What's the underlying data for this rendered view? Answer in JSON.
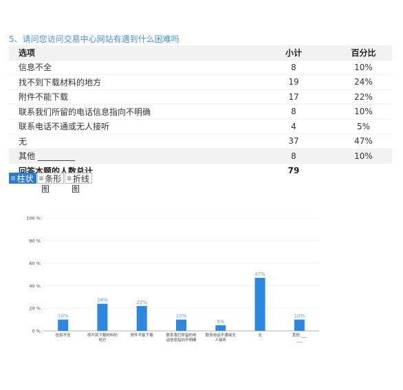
{
  "question": {
    "title": "5、请问您访问交易中心网站有遇到什么困难吗"
  },
  "table": {
    "headers": [
      "选项",
      "小计",
      "百分比"
    ],
    "rows": [
      {
        "option": "信息不全",
        "count": "8",
        "pct": "10%"
      },
      {
        "option": "找不到下载材料的地方",
        "count": "19",
        "pct": "24%"
      },
      {
        "option": "附件不能下载",
        "count": "17",
        "pct": "22%"
      },
      {
        "option": "联系我们所留的电话信息指向不明确",
        "count": "8",
        "pct": "10%"
      },
      {
        "option": "联系电话不通或无人接听",
        "count": "4",
        "pct": "5%"
      },
      {
        "option": "无",
        "count": "37",
        "pct": "47%"
      },
      {
        "option": "其他 _________",
        "count": "8",
        "pct": "10%"
      }
    ],
    "total_label": "回答本题的人数总计",
    "total_value": "79"
  },
  "chart_tabs": {
    "bar_col": "柱状",
    "bar_row": "条形",
    "line": "折线",
    "sub_char": "图"
  },
  "colors": {
    "bar": "#2b87e0",
    "accent": "#2b7bd3",
    "title": "#4a90d9"
  },
  "chart_data": {
    "type": "bar",
    "categories": [
      "信息不全",
      "找不到下载材料的地方",
      "附件不能下载",
      "联系我们所留的电话信息指向不明确",
      "联系电话不通或无人接听",
      "无",
      "其他 _________"
    ],
    "category_lines": [
      [
        "信息不全"
      ],
      [
        "找不到下载材料的",
        "地方"
      ],
      [
        "附件不能下载"
      ],
      [
        "联系我们所留的电",
        "话信息指向不明确"
      ],
      [
        "联系电话不通或无",
        "人接听"
      ],
      [
        "无"
      ],
      [
        "其他 ___",
        "___"
      ]
    ],
    "values": [
      10,
      24,
      22,
      10,
      5,
      47,
      10
    ],
    "labels": [
      "10%",
      "24%",
      "22%",
      "10%",
      "5%",
      "47%",
      "10%"
    ],
    "yticks": [
      "0 %",
      "20 %",
      "40 %",
      "60 %",
      "80 %",
      "100 %"
    ],
    "ylim": [
      0,
      100
    ],
    "grid": true
  }
}
